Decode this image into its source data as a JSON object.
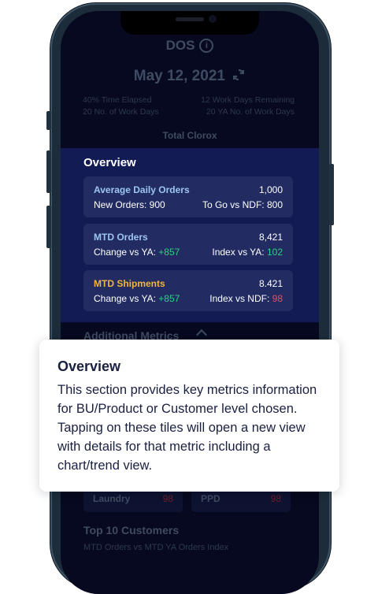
{
  "header": {
    "title": "DOS",
    "info_icon": "i",
    "date": "May 12, 2021",
    "refresh_icon": "refresh-icon"
  },
  "stats": {
    "time_elapsed": "40% Time Elapsed",
    "work_days": "20 No. of Work Days",
    "remaining": "12 Work Days Remaining",
    "ya_work_days": "20 YA No. of Work Days"
  },
  "scope": "Total Clorox",
  "overview": {
    "title": "Overview",
    "tiles": [
      {
        "name": "Average Daily Orders",
        "value": "1,000",
        "left_label": "New Orders: 900",
        "left_delta": "",
        "right_label": "To Go vs NDF: 800",
        "right_value": ""
      },
      {
        "name": "MTD Orders",
        "value": "8,421",
        "left_label": "Change vs YA: ",
        "left_delta": "+857",
        "right_label": "Index vs YA: ",
        "right_value": "102"
      },
      {
        "name": "MTD Shipments",
        "value": "8.421",
        "left_label": "Change vs YA: ",
        "left_delta": "+857",
        "right_label": "Index vs NDF: ",
        "right_value": "98"
      }
    ]
  },
  "additional": {
    "title": "Additional Metrics"
  },
  "metric_tiles": [
    {
      "label": "Laundry",
      "value": "98"
    },
    {
      "label": "PPD",
      "value": "98"
    }
  ],
  "top10": {
    "title": "Top 10 Customers",
    "subtitle": "MTD Orders vs MTD YA Orders Index"
  },
  "tooltip": {
    "title": "Overview",
    "body": "This section provides key metrics information for BU/Product or Customer level chosen. Tapping on these tiles will open a new view with details for that metric including a chart/trend view."
  },
  "colors": {
    "screen_bg": "#06091f",
    "overview_bg": "#121b54",
    "tile_bg": "#222c63",
    "positive": "#2fd27c",
    "negative": "#ee4d62",
    "accent_gold": "#f1b43c"
  }
}
